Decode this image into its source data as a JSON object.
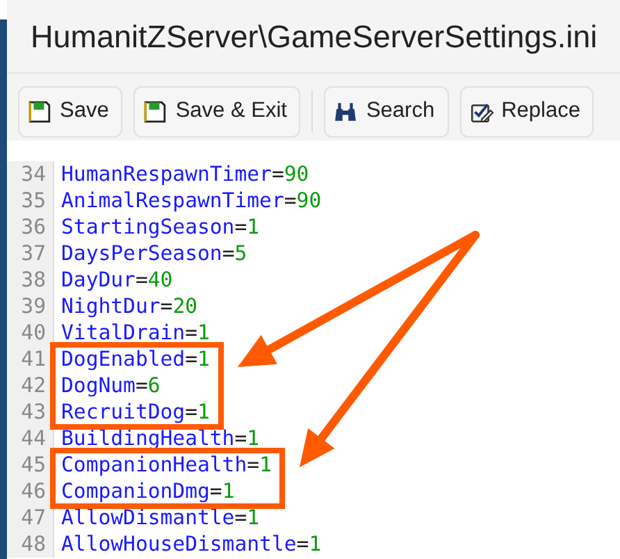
{
  "window": {
    "title": "HumanitZServer\\GameServerSettings.ini"
  },
  "toolbar": [
    {
      "label": "Save",
      "kind": "save"
    },
    {
      "label": "Save & Exit",
      "kind": "save"
    },
    {
      "label": "Search",
      "kind": "search"
    },
    {
      "label": "Replace",
      "kind": "replace"
    }
  ],
  "editor": {
    "lines": [
      {
        "n": "34",
        "key": "HumanRespawnTimer",
        "eq": "=",
        "value": "90",
        "boxed": false
      },
      {
        "n": "35",
        "key": "AnimalRespawnTimer",
        "eq": "=",
        "value": "90",
        "boxed": false
      },
      {
        "n": "36",
        "key": "StartingSeason",
        "eq": "=",
        "value": "1",
        "boxed": false
      },
      {
        "n": "37",
        "key": "DaysPerSeason",
        "eq": "=",
        "value": "5",
        "boxed": false
      },
      {
        "n": "38",
        "key": "DayDur",
        "eq": "=",
        "value": "40",
        "boxed": false
      },
      {
        "n": "39",
        "key": "NightDur",
        "eq": "=",
        "value": "20",
        "boxed": false
      },
      {
        "n": "40",
        "key": "VitalDrain",
        "eq": "=",
        "value": "1",
        "boxed": false
      },
      {
        "n": "41",
        "key": "DogEnabled",
        "eq": "=",
        "value": "1",
        "boxed": true
      },
      {
        "n": "42",
        "key": "DogNum",
        "eq": "=",
        "value": "6",
        "boxed": true
      },
      {
        "n": "43",
        "key": "RecruitDog",
        "eq": "=",
        "value": "1",
        "boxed": true
      },
      {
        "n": "44",
        "key": "BuildingHealth",
        "eq": "=",
        "value": "1",
        "boxed": false
      },
      {
        "n": "45",
        "key": "CompanionHealth",
        "eq": "=",
        "value": "1",
        "boxed": true
      },
      {
        "n": "46",
        "key": "CompanionDmg",
        "eq": "=",
        "value": "1",
        "boxed": true
      },
      {
        "n": "47",
        "key": "AllowDismantle",
        "eq": "=",
        "value": "1",
        "boxed": false
      },
      {
        "n": "48",
        "key": "AllowHouseDismantle",
        "eq": "=",
        "value": "1",
        "boxed": false
      }
    ]
  }
}
